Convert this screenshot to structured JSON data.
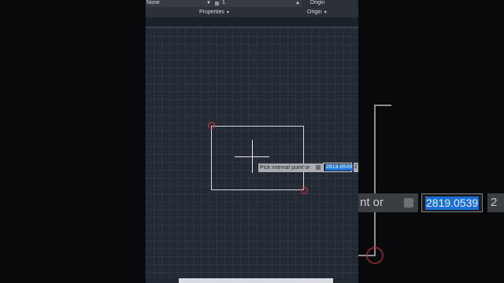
{
  "ribbon": {
    "layer_value": "None",
    "lineweight_value": "1",
    "origin_button": "Origin",
    "properties_title": "Properties",
    "origin_title": "Origin"
  },
  "canvas": {
    "prompt_text": "Pick internal point or",
    "input_value": "2819.0539",
    "input2_value": "2"
  },
  "zoom_overlay": {
    "prompt_text": "nt or",
    "input_value": "2819.0539",
    "input2_value": "2"
  },
  "colors": {
    "canvas_bg": "#232a33",
    "selection_blue": "#1b74e0",
    "marker_red": "#c0363f"
  }
}
